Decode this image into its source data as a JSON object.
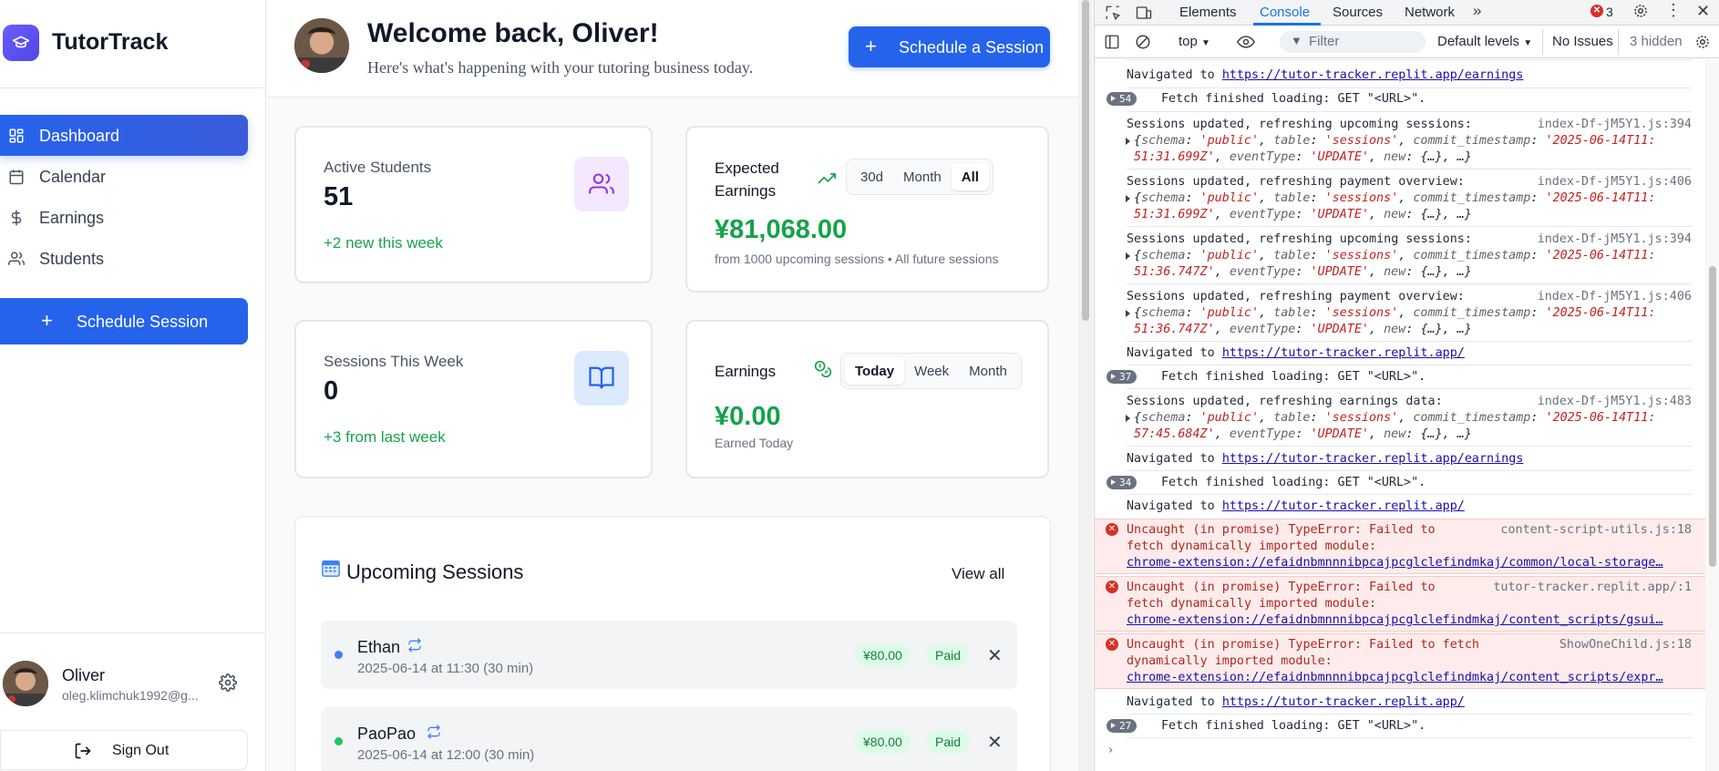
{
  "sidebar": {
    "brand": "TutorTrack",
    "nav": [
      {
        "label": "Dashboard",
        "icon": "grid-icon",
        "active": true
      },
      {
        "label": "Calendar",
        "icon": "calendar-icon"
      },
      {
        "label": "Earnings",
        "icon": "dollar-icon"
      },
      {
        "label": "Students",
        "icon": "users-icon"
      }
    ],
    "schedule_label": "Schedule Session",
    "user": {
      "name": "Oliver",
      "email": "oleg.klimchuk1992@g..."
    },
    "sign_out": "Sign Out"
  },
  "header": {
    "welcome": "Welcome back, Oliver!",
    "subtitle": "Here's what's happening with your tutoring business today.",
    "schedule_button": "Schedule a Session"
  },
  "stats": {
    "active_students": {
      "label": "Active Students",
      "value": "51",
      "delta": "+2 new this week"
    },
    "sessions_week": {
      "label": "Sessions This Week",
      "value": "0",
      "delta": "+3 from last week"
    }
  },
  "expected": {
    "title_line1": "Expected",
    "title_line2": "Earnings",
    "options": [
      "30d",
      "Month",
      "All"
    ],
    "selected": "All",
    "amount": "¥81,068.00",
    "sub": "from 1000 upcoming sessions • All future sessions"
  },
  "earnings": {
    "title": "Earnings",
    "options": [
      "Today",
      "Week",
      "Month"
    ],
    "selected": "Today",
    "amount": "¥0.00",
    "sub": "Earned Today"
  },
  "upcoming": {
    "title": "Upcoming Sessions",
    "view_all": "View all",
    "sessions": [
      {
        "name": "Ethan",
        "time": "2025-06-14 at 11:30 (30 min)",
        "price": "¥80.00",
        "status": "Paid",
        "dot": "#3b82f6"
      },
      {
        "name": "PaoPao",
        "time": "2025-06-14 at 12:00 (30 min)",
        "price": "¥80.00",
        "status": "Paid",
        "dot": "#22c55e"
      }
    ]
  },
  "devtools": {
    "tabs": [
      "Elements",
      "Console",
      "Sources",
      "Network"
    ],
    "active_tab": "Console",
    "error_count": "3",
    "context": "top",
    "filter_placeholder": "Filter",
    "levels": "Default levels",
    "issues": "No Issues",
    "hidden": "3 hidden",
    "log": {
      "nav1": {
        "prefix": "Navigated to ",
        "url": "https://tutor-tracker.replit.app/earnings"
      },
      "fetch1": {
        "count": "54",
        "text": "Fetch finished loading: GET \"<URL>\"."
      },
      "m1": {
        "text": "Sessions updated, refreshing upcoming sessions:",
        "src": "index-Df-jM5Y1.js:394",
        "l1b": "'2025-06-14T11:",
        "l2a": "51:31.699Z'"
      },
      "m2": {
        "text": "Sessions updated, refreshing payment overview:",
        "src": "index-Df-jM5Y1.js:406",
        "l1b": "'2025-06-14T11:",
        "l2a": "51:31.699Z'"
      },
      "m3": {
        "text": "Sessions updated, refreshing upcoming sessions:",
        "src": "index-Df-jM5Y1.js:394",
        "l1b": "'2025-06-14T11:",
        "l2a": "51:36.747Z'"
      },
      "m4": {
        "text": "Sessions updated, refreshing payment overview:",
        "src": "index-Df-jM5Y1.js:406",
        "l1b": "'2025-06-14T11:",
        "l2a": "51:36.747Z'"
      },
      "nav2": {
        "prefix": "Navigated to ",
        "url": "https://tutor-tracker.replit.app/"
      },
      "fetch2": {
        "count": "37",
        "text": "Fetch finished loading: GET \"<URL>\"."
      },
      "m5": {
        "text": "Sessions updated, refreshing earnings data:",
        "src": "index-Df-jM5Y1.js:483",
        "l1b": "'2025-06-14T11:",
        "l2a": "57:45.684Z'"
      },
      "nav3": {
        "prefix": "Navigated to ",
        "url": "https://tutor-tracker.replit.app/earnings"
      },
      "fetch3": {
        "count": "34",
        "text": "Fetch finished loading: GET \"<URL>\"."
      },
      "nav4": {
        "prefix": "Navigated to ",
        "url": "https://tutor-tracker.replit.app/"
      },
      "e1": {
        "l1": "Uncaught (in promise) TypeError: Failed to",
        "l2": "fetch dynamically imported module:",
        "link": "chrome-extension://efaidnbmnnnibpcajpcglclefindmkaj/common/local-storage…",
        "src": "content-script-utils.js:18"
      },
      "e2": {
        "l1": "Uncaught (in promise) TypeError: Failed to",
        "l2": "fetch dynamically imported module:",
        "link": "chrome-extension://efaidnbmnnnibpcajpcglclefindmkaj/content_scripts/gsui…",
        "src": "tutor-tracker.replit.app/:1"
      },
      "e3": {
        "l1": "Uncaught (in promise) TypeError: Failed to fetch",
        "l2": "dynamically imported module:",
        "link": "chrome-extension://efaidnbmnnnibpcajpcglclefindmkaj/content_scripts/expr…",
        "src": "ShowOneChild.js:18"
      },
      "nav5": {
        "prefix": "Navigated to ",
        "url": "https://tutor-tracker.replit.app/"
      },
      "fetch4": {
        "count": "27",
        "text": "Fetch finished loading: GET \"<URL>\"."
      }
    },
    "obj": {
      "schema_k": "schema",
      "schema_v": "'public'",
      "table_k": "table",
      "table_v": "'sessions'",
      "commit_k": "commit_timestamp",
      "event_k": "eventType",
      "event_v": "'UPDATE'",
      "new_k": "new",
      "ellipsis": "{…}, …}"
    }
  }
}
